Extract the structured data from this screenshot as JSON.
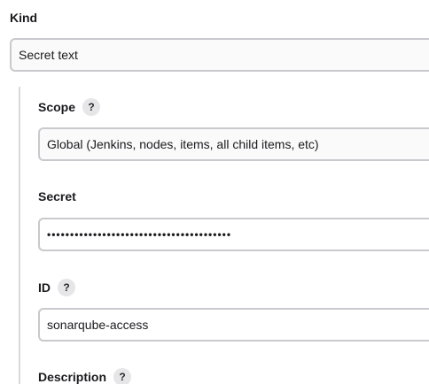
{
  "kind": {
    "label": "Kind",
    "value": "Secret text"
  },
  "scope": {
    "label": "Scope",
    "help": "?",
    "value": "Global (Jenkins, nodes, items, all child items, etc)"
  },
  "secret": {
    "label": "Secret",
    "value": "••••••••••••••••••••••••••••••••••••••••"
  },
  "id": {
    "label": "ID",
    "help": "?",
    "value": "sonarqube-access"
  },
  "description": {
    "label": "Description",
    "help": "?"
  }
}
